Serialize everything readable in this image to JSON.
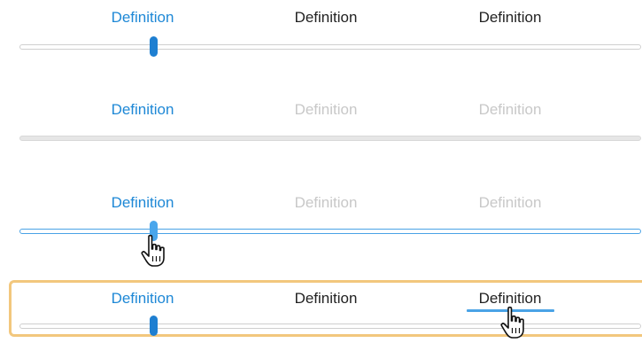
{
  "rows": [
    {
      "state": "normal",
      "labels": [
        "Definition",
        "Definition",
        "Definition"
      ]
    },
    {
      "state": "disabled",
      "labels": [
        "Definition",
        "Definition",
        "Definition"
      ]
    },
    {
      "state": "hover",
      "labels": [
        "Definition",
        "Definition",
        "Definition"
      ]
    },
    {
      "state": "focused",
      "labels": [
        "Definition",
        "Definition",
        "Definition"
      ]
    }
  ],
  "icons": {
    "cursor": "hand-pointer-icon"
  },
  "colors": {
    "accent": "#1e88d6",
    "thumb": "#1e7fd1",
    "thumb_hover": "#49a6ec",
    "focus_border": "#f2c77d",
    "text": "#222222",
    "disabled_text": "#c8c8c8"
  }
}
